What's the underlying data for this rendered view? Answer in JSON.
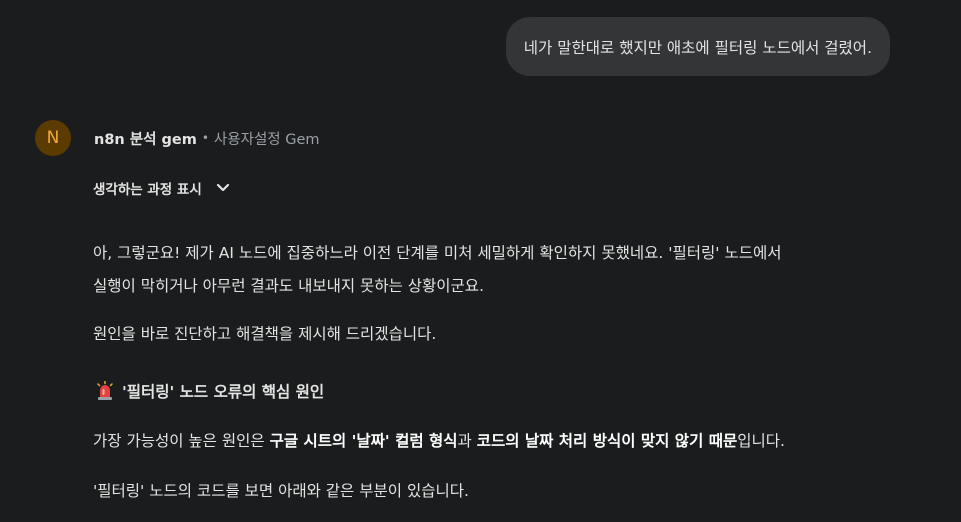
{
  "user_message": {
    "text": "네가 말한대로 했지만 애초에 필터링 노드에서 걸렸어."
  },
  "response": {
    "avatar_letter": "N",
    "gem_name": "n8n 분석 gem",
    "separator": "•",
    "gem_type": "사용자설정 Gem",
    "thinking_label": "생각하는 과정 표시",
    "paragraph1_line1": "아, 그렇군요! 제가 AI 노드에 집중하느라 이전 단계를 미처 세밀하게 확인하지 못했네요. '필터링' 노드에서",
    "paragraph1_line2": "실행이 막히거나 아무런 결과도 내보내지 못하는 상황이군요.",
    "paragraph2": "원인을 바로 진단하고 해결책을 제시해 드리겠습니다.",
    "heading": "'필터링' 노드 오류의 핵심 원인",
    "paragraph3": {
      "part1": "가장 가능성이 높은 원인은 ",
      "bold1": "구글 시트의 '날짜' 컬럼 형식",
      "part2": "과 ",
      "bold2": "코드의 날짜 처리 방식이 맞지 않기 때문",
      "part3": "입니다."
    },
    "paragraph4": "'필터링' 노드의 코드를 보면 아래와 같은 부분이 있습니다."
  },
  "colors": {
    "background": "#1b1c1d",
    "bubble": "#333537",
    "avatar_bg": "#5c3b00",
    "avatar_fg": "#f0a93a",
    "text": "#e3e3e3",
    "muted": "#9aa0a6"
  },
  "icons": {
    "thinking_toggle": "chevron-down-icon",
    "heading": "siren-icon"
  }
}
